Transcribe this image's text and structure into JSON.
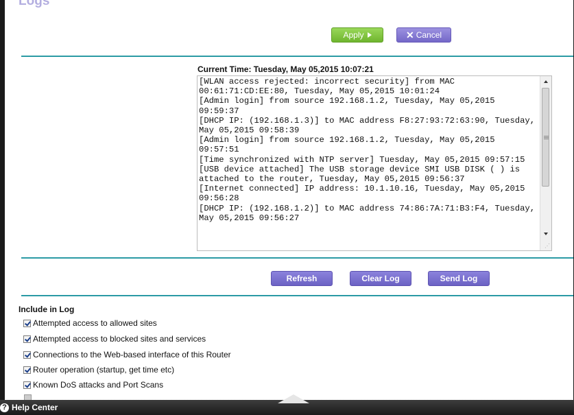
{
  "header": {
    "title": "Logs"
  },
  "actions": {
    "apply_label": "Apply",
    "cancel_label": "Cancel"
  },
  "log": {
    "current_time": "Current Time: Tuesday, May 05,2015 10:07:21",
    "entries": "[WLAN access rejected: incorrect security] from MAC 00:61:71:CD:EE:80, Tuesday, May 05,2015 10:01:24\n[Admin login] from source 192.168.1.2, Tuesday, May 05,2015 09:59:37\n[DHCP IP: (192.168.1.3)] to MAC address F8:27:93:72:63:90, Tuesday, May 05,2015 09:58:39\n[Admin login] from source 192.168.1.2, Tuesday, May 05,2015 09:57:51\n[Time synchronized with NTP server] Tuesday, May 05,2015 09:57:15\n[USB device attached] The USB storage device SMI USB DISK ( ) is attached to the router, Tuesday, May 05,2015 09:56:37\n[Internet connected] IP address: 10.1.10.16, Tuesday, May 05,2015 09:56:28\n[DHCP IP: (192.168.1.2)] to MAC address 74:86:7A:71:B3:F4, Tuesday, May 05,2015 09:56:27"
  },
  "log_buttons": {
    "refresh": "Refresh",
    "clear": "Clear Log",
    "send": "Send Log"
  },
  "include": {
    "heading": "Include in Log",
    "options": [
      {
        "label": "Attempted access to allowed sites",
        "checked": true
      },
      {
        "label": "Attempted access to blocked sites and services",
        "checked": true
      },
      {
        "label": "Connections to the Web-based interface of this Router",
        "checked": true
      },
      {
        "label": "Router operation (startup, get time etc)",
        "checked": true
      },
      {
        "label": "Known DoS attacks and Port Scans",
        "checked": true
      }
    ]
  },
  "footer": {
    "help_label": "Help Center",
    "help_icon": "?"
  },
  "colors": {
    "apply": "#7cc243",
    "purple_button": "#7b70d0",
    "rule": "#2a9aa4",
    "title": "#b3aee0",
    "footer": "#2b2b2b"
  }
}
